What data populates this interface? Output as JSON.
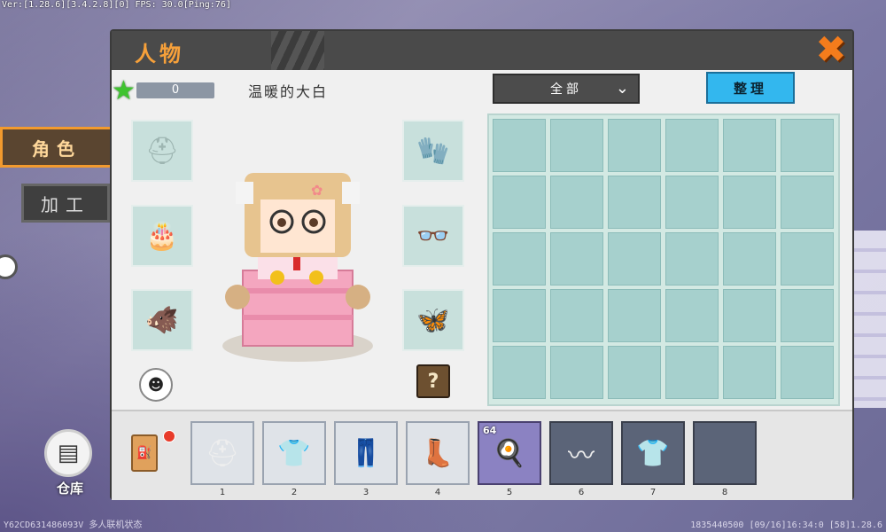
{
  "hud": {
    "top_left": "Ver:[1.28.6][3.4.2.8][0] FPS: 30.0[Ping:76]",
    "bottom_left": "Y62CD631486093V 多人联机状态",
    "bottom_right": "1835440500  [09/16]16:34:0  [58]1.28.6"
  },
  "side_tabs": {
    "role": "角色",
    "craft": "加工"
  },
  "warehouse": {
    "label": "仓库"
  },
  "panel": {
    "title": "人物",
    "close_symbol": "✖",
    "star_count": "0",
    "character_name": "温暖的大白",
    "filter": {
      "label": "全部",
      "chevron": "⌄"
    },
    "sort_label": "整理",
    "help_symbol": "?"
  },
  "equipment_slots": {
    "left": [
      {
        "icon": "helmet-icon",
        "glyph": "⛑"
      },
      {
        "icon": "cake-icon",
        "glyph": "🎂"
      },
      {
        "icon": "beast-icon",
        "glyph": "🐗"
      }
    ],
    "right": [
      {
        "icon": "gloves-icon",
        "glyph": "🧤"
      },
      {
        "icon": "glasses-icon",
        "glyph": "👓"
      },
      {
        "icon": "pet-icon",
        "glyph": "🦋"
      }
    ]
  },
  "backpack": {
    "rows": 5,
    "cols": 6
  },
  "hotbar": [
    {
      "num": "1",
      "icon": "chain-helmet-icon",
      "glyph": "⛑",
      "style": "light"
    },
    {
      "num": "2",
      "icon": "chain-chestplate-icon",
      "glyph": "👕",
      "style": "light"
    },
    {
      "num": "3",
      "icon": "chain-leggings-icon",
      "glyph": "👖",
      "style": "light"
    },
    {
      "num": "4",
      "icon": "chain-boots-icon",
      "glyph": "👢",
      "style": "light"
    },
    {
      "num": "5",
      "icon": "egg-bowl-icon",
      "glyph": "🍳",
      "style": "food",
      "count": "64"
    },
    {
      "num": "6",
      "icon": "feather-icon",
      "glyph": "〰",
      "style": "dark"
    },
    {
      "num": "7",
      "icon": "jersey-icon",
      "glyph": "👕",
      "style": "dark"
    },
    {
      "num": "8",
      "icon": "empty-icon",
      "glyph": "",
      "style": "dark"
    }
  ],
  "colors": {
    "accent_orange": "#f29a2e",
    "sort_blue": "#33b7ee",
    "grid_cell": "#a6d0cd"
  }
}
